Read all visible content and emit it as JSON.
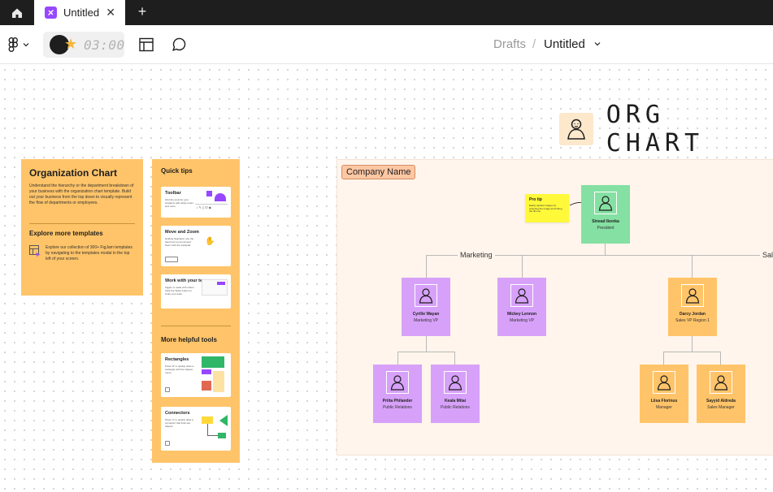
{
  "tabs": {
    "home_icon": "home-icon",
    "active_tab": {
      "title": "Untitled",
      "icon": "figjam-icon",
      "close_glyph": "✕"
    },
    "new_tab_glyph": "+"
  },
  "toolbar": {
    "timer_text": "03:00",
    "breadcrumb": {
      "folder": "Drafts",
      "separator": "/",
      "file": "Untitled"
    }
  },
  "canvas": {
    "banner_title": "ORG CHART",
    "intro_card": {
      "title": "Organization Chart",
      "body": "Understand the hierarchy or the department breakdown of your business with the organization chart template. Build out your business from the top down to visually represent the flow of departments or employees.",
      "subtitle": "Explore more templates",
      "explore_text": "Explore our collection of 300+ FigJam templates by navigating to the templates modal in the top left of your screen."
    },
    "quick_tips": {
      "title": "Quick tips",
      "cards": [
        {
          "title": "Toolbar",
          "body": "Find the tools for your creations with sticky notes and more."
        },
        {
          "title": "Move and Zoom",
          "body": "Holding Spacebar, use the hand tool to pan around. Zoom with the trackpad."
        },
        {
          "title": "Work with your team",
          "body": "Figjam is made with others. Click the Share button to invite your team."
        }
      ],
      "more_title": "More helpful tools",
      "more_cards": [
        {
          "title": "Rectangles",
          "body": "Press 'R' to quickly draw a rectangle with the shapes menu."
        },
        {
          "title": "Connectors",
          "body": "Press 'X' to quickly draw a connector that links two objects."
        }
      ]
    },
    "company_name": "Company Name",
    "sticky": {
      "title": "Pro tip",
      "body": "Easily replace images by selecting the image and hitting the fill icon"
    },
    "departments": [
      "Marketing",
      "Sal"
    ],
    "people": {
      "president": {
        "name": "Sinead Ikonka",
        "role": "President"
      },
      "marketing_vp_1": {
        "name": "Cyrille Wayan",
        "role": "Marketing VP"
      },
      "marketing_vp_2": {
        "name": "Mickey Lennon",
        "role": "Marketing VP"
      },
      "pr_1": {
        "name": "Priita Philander",
        "role": "Public Relations"
      },
      "pr_2": {
        "name": "Keala Mitai",
        "role": "Public Relations"
      },
      "sales_vp": {
        "name": "Darcy Jordan",
        "role": "Sales VP Region 1"
      },
      "manager_1": {
        "name": "Liisa Florinus",
        "role": "Manager"
      },
      "manager_2": {
        "name": "Sayyid Aldreda",
        "role": "Sales Manager"
      }
    }
  },
  "colors": {
    "president": "#85e0a3",
    "marketing": "#d7a1f9",
    "sales": "#ffc469",
    "section_bg": "#fff5ec",
    "tab_accent": "#9747ff"
  }
}
